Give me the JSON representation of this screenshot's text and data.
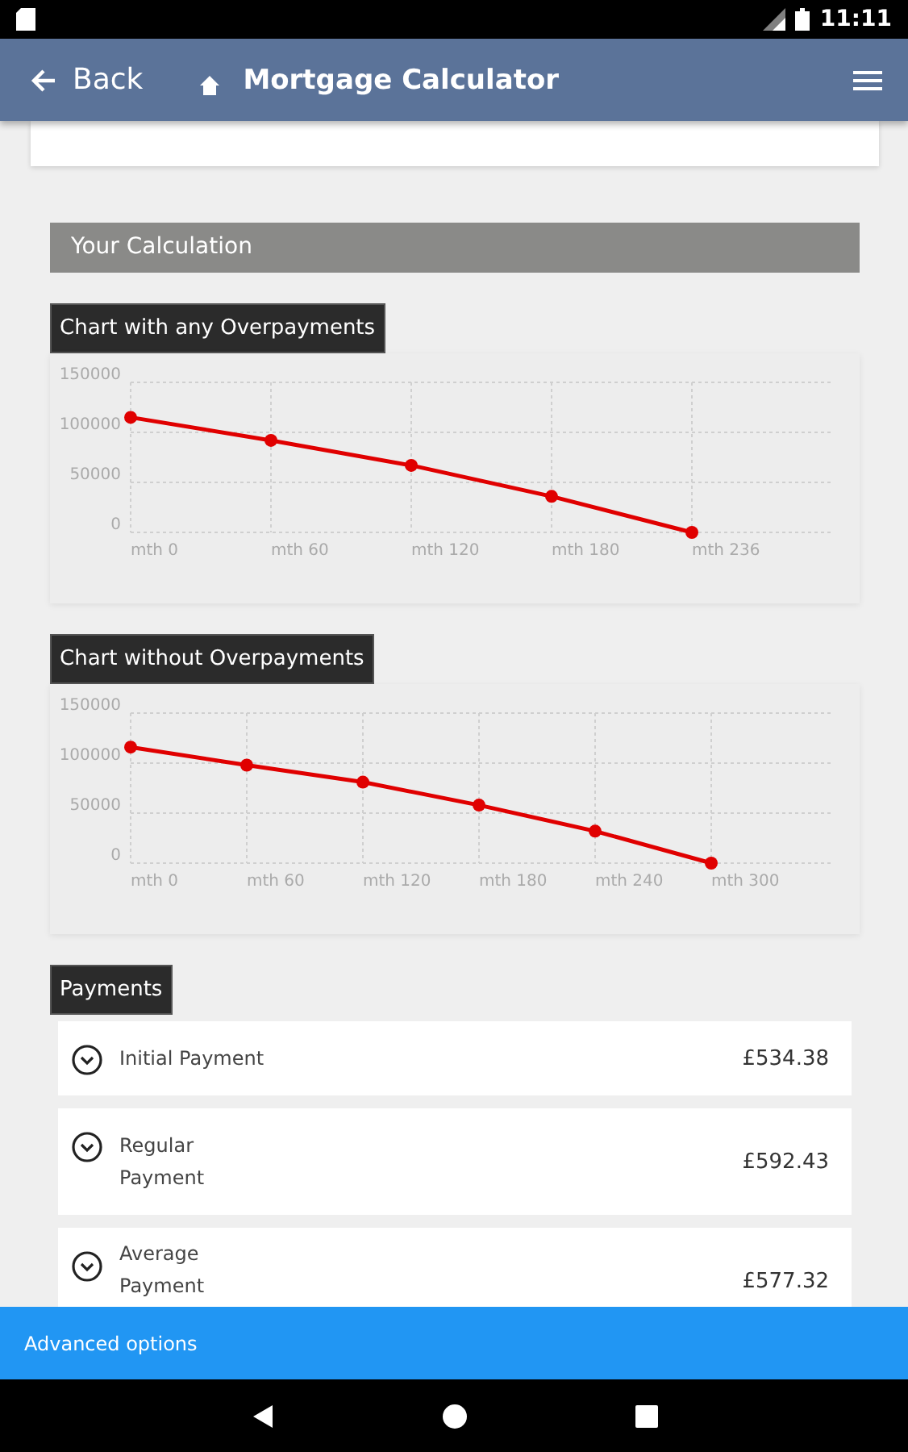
{
  "status_bar": {
    "time": "11:11"
  },
  "app_bar": {
    "back_label": "Back",
    "title": "Mortgage Calculator"
  },
  "section_title": "Your Calculation",
  "charts": [
    {
      "title": "Chart with any Overpayments",
      "chart_data": {
        "type": "line",
        "categories": [
          "mth 0",
          "mth 60",
          "mth 120",
          "mth 180",
          "mth 236"
        ],
        "series": [
          {
            "color": "#e00000",
            "marker": "circle",
            "values": [
              115000,
              92000,
              67000,
              36000,
              0
            ]
          }
        ],
        "ylim": [
          0,
          150000
        ],
        "yticks": [
          0,
          50000,
          100000,
          150000
        ]
      }
    },
    {
      "title": "Chart without Overpayments",
      "chart_data": {
        "type": "line",
        "categories": [
          "mth 0",
          "mth 60",
          "mth 120",
          "mth 180",
          "mth 240",
          "mth 300"
        ],
        "series": [
          {
            "color": "#e00000",
            "marker": "circle",
            "values": [
              116000,
              98000,
              81000,
              58000,
              32000,
              0
            ]
          }
        ],
        "ylim": [
          0,
          150000
        ],
        "yticks": [
          0,
          50000,
          100000,
          150000
        ]
      }
    }
  ],
  "payments": {
    "title": "Payments",
    "rows": [
      {
        "label": "Initial Payment",
        "value": "£534.38"
      },
      {
        "label": "Regular\nPayment",
        "value": "£592.43"
      },
      {
        "label": "Average\nPayment",
        "value": "£577.32"
      }
    ]
  },
  "bottom_bar": {
    "label": "Advanced options"
  }
}
